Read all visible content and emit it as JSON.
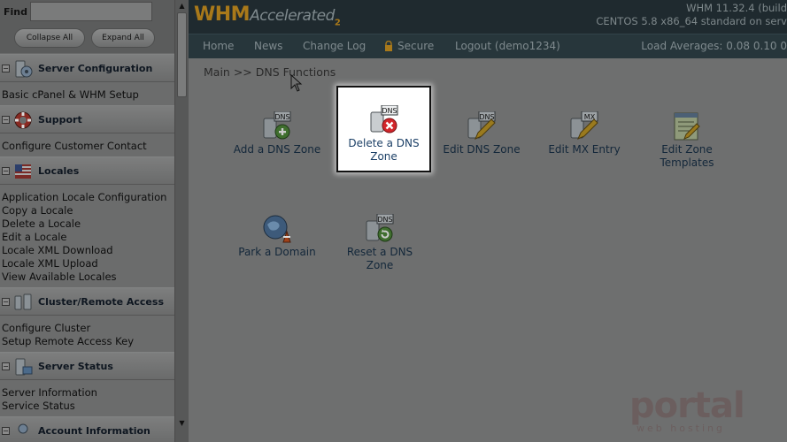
{
  "sidebar": {
    "find_label": "Find",
    "find_placeholder": "",
    "collapse_all": "Collapse All",
    "expand_all": "Expand All",
    "sections": [
      {
        "title": "Server Configuration",
        "icon": "server-config-icon",
        "items": [
          "Basic cPanel & WHM Setup"
        ]
      },
      {
        "title": "Support",
        "icon": "lifebuoy-icon",
        "items": [
          "Configure Customer Contact"
        ]
      },
      {
        "title": "Locales",
        "icon": "flag-icon",
        "items": [
          "Application Locale Configuration",
          "Copy a Locale",
          "Delete a Locale",
          "Edit a Locale",
          "Locale XML Download",
          "Locale XML Upload",
          "View Available Locales"
        ]
      },
      {
        "title": "Cluster/Remote Access",
        "icon": "cluster-icon",
        "items": [
          "Configure Cluster",
          "Setup Remote Access Key"
        ]
      },
      {
        "title": "Server Status",
        "icon": "server-status-icon",
        "items": [
          "Server Information",
          "Service Status"
        ]
      },
      {
        "title": "Account Information",
        "icon": "account-icon",
        "items": []
      }
    ]
  },
  "header": {
    "logo_main": "WHM",
    "logo_accel": "Accelerated",
    "logo_sub": "2",
    "version": "WHM 11.32.4 (build",
    "os": "CENTOS 5.8 x86_64 standard on serv"
  },
  "nav": {
    "home": "Home",
    "news": "News",
    "changelog": "Change Log",
    "secure": "Secure",
    "logout": "Logout (demo1234)",
    "load": "Load Averages: 0.08 0.10 0"
  },
  "breadcrumb": "Main >> DNS Functions",
  "functions": [
    {
      "label": "Add a DNS Zone",
      "icon": "dns-add-icon"
    },
    {
      "label": "Delete a DNS Zone",
      "icon": "dns-delete-icon"
    },
    {
      "label": "Edit DNS Zone",
      "icon": "dns-edit-icon"
    },
    {
      "label": "Edit MX Entry",
      "icon": "mx-edit-icon"
    },
    {
      "label": "Edit Zone Templates",
      "icon": "zone-templates-icon"
    },
    {
      "label": "Park a Domain",
      "icon": "park-domain-icon"
    },
    {
      "label": "Reset a DNS Zone",
      "icon": "dns-reset-icon"
    }
  ],
  "watermark": "portal web hosting"
}
